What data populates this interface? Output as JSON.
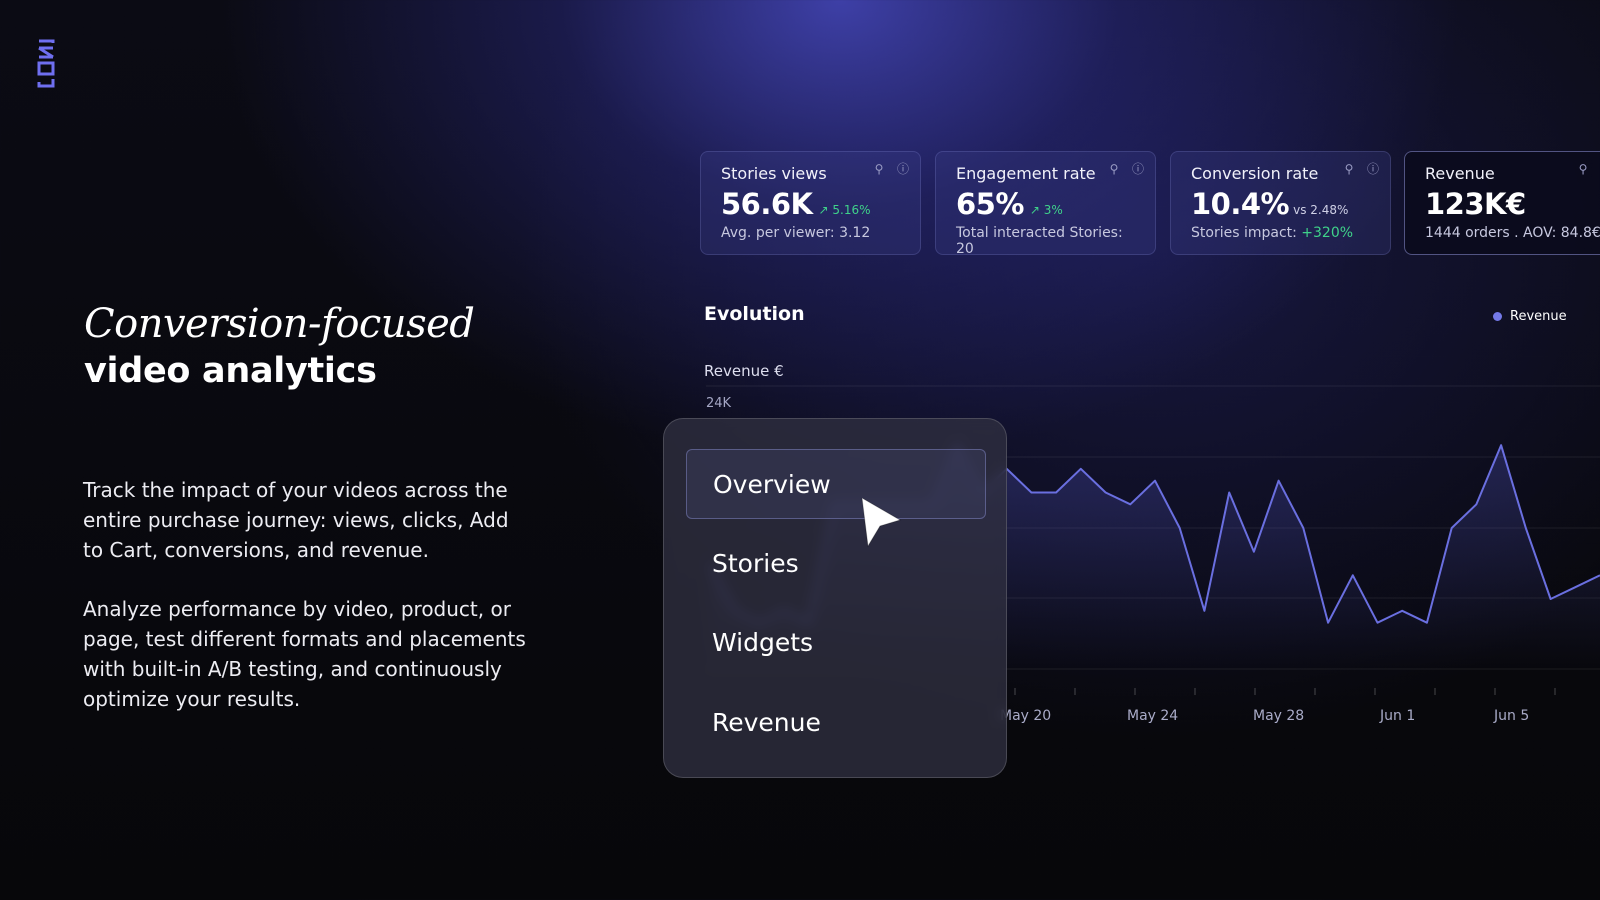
{
  "brand": {
    "logo_text": "JOIN",
    "accent": "#6f6ff0"
  },
  "hero": {
    "headline_serif": "Conversion-focused",
    "headline_bold": "video analytics",
    "paragraph1": "Track the impact of your videos across the entire purchase journey: views, clicks, Add to Cart, conversions, and revenue.",
    "paragraph2": "Analyze performance by video, product, or page, test different formats and placements with built-in A/B testing, and continuously optimize your results."
  },
  "metrics": [
    {
      "title": "Stories views",
      "value": "56.6K",
      "delta": "↗ 5.16%",
      "sub": "Avg. per viewer: 3.12",
      "icons": [
        "pin-icon",
        "info-icon"
      ]
    },
    {
      "title": "Engagement rate",
      "value": "65%",
      "delta": "↗ 3%",
      "sub": "Total interacted Stories: 20",
      "icons": [
        "pin-icon",
        "info-icon"
      ]
    },
    {
      "title": "Conversion rate",
      "value": "10.4%",
      "vs": "vs 2.48%",
      "sub_prefix": "Stories impact: ",
      "sub_highlight": "+320%",
      "icons": [
        "pin-icon",
        "info-icon"
      ]
    },
    {
      "title": "Revenue",
      "value": "123K€",
      "sub": "1444 orders . AOV: 84.8€",
      "icons": [
        "pin-icon"
      ]
    }
  ],
  "evolution": {
    "title": "Evolution",
    "legend": "Revenue",
    "line_color": "#6a6fe0"
  },
  "chart_data": {
    "type": "line",
    "ylabel": "Revenue €",
    "y_ticks_visible": [
      "24K"
    ],
    "x_ticks": [
      "May 20",
      "May 24",
      "May 28",
      "Jun 1",
      "Jun 5"
    ],
    "series": [
      {
        "name": "Revenue",
        "values": [
          9,
          5,
          4,
          5,
          4,
          14,
          14,
          14,
          14,
          14,
          19,
          15,
          17,
          15,
          15,
          17,
          15,
          14,
          16,
          12,
          5,
          15,
          10,
          16,
          12,
          4,
          8,
          4,
          5,
          4,
          12,
          14,
          19,
          12,
          6,
          7,
          8
        ]
      }
    ]
  },
  "menu": {
    "items": [
      "Overview",
      "Stories",
      "Widgets",
      "Revenue"
    ],
    "selected": "Overview"
  }
}
